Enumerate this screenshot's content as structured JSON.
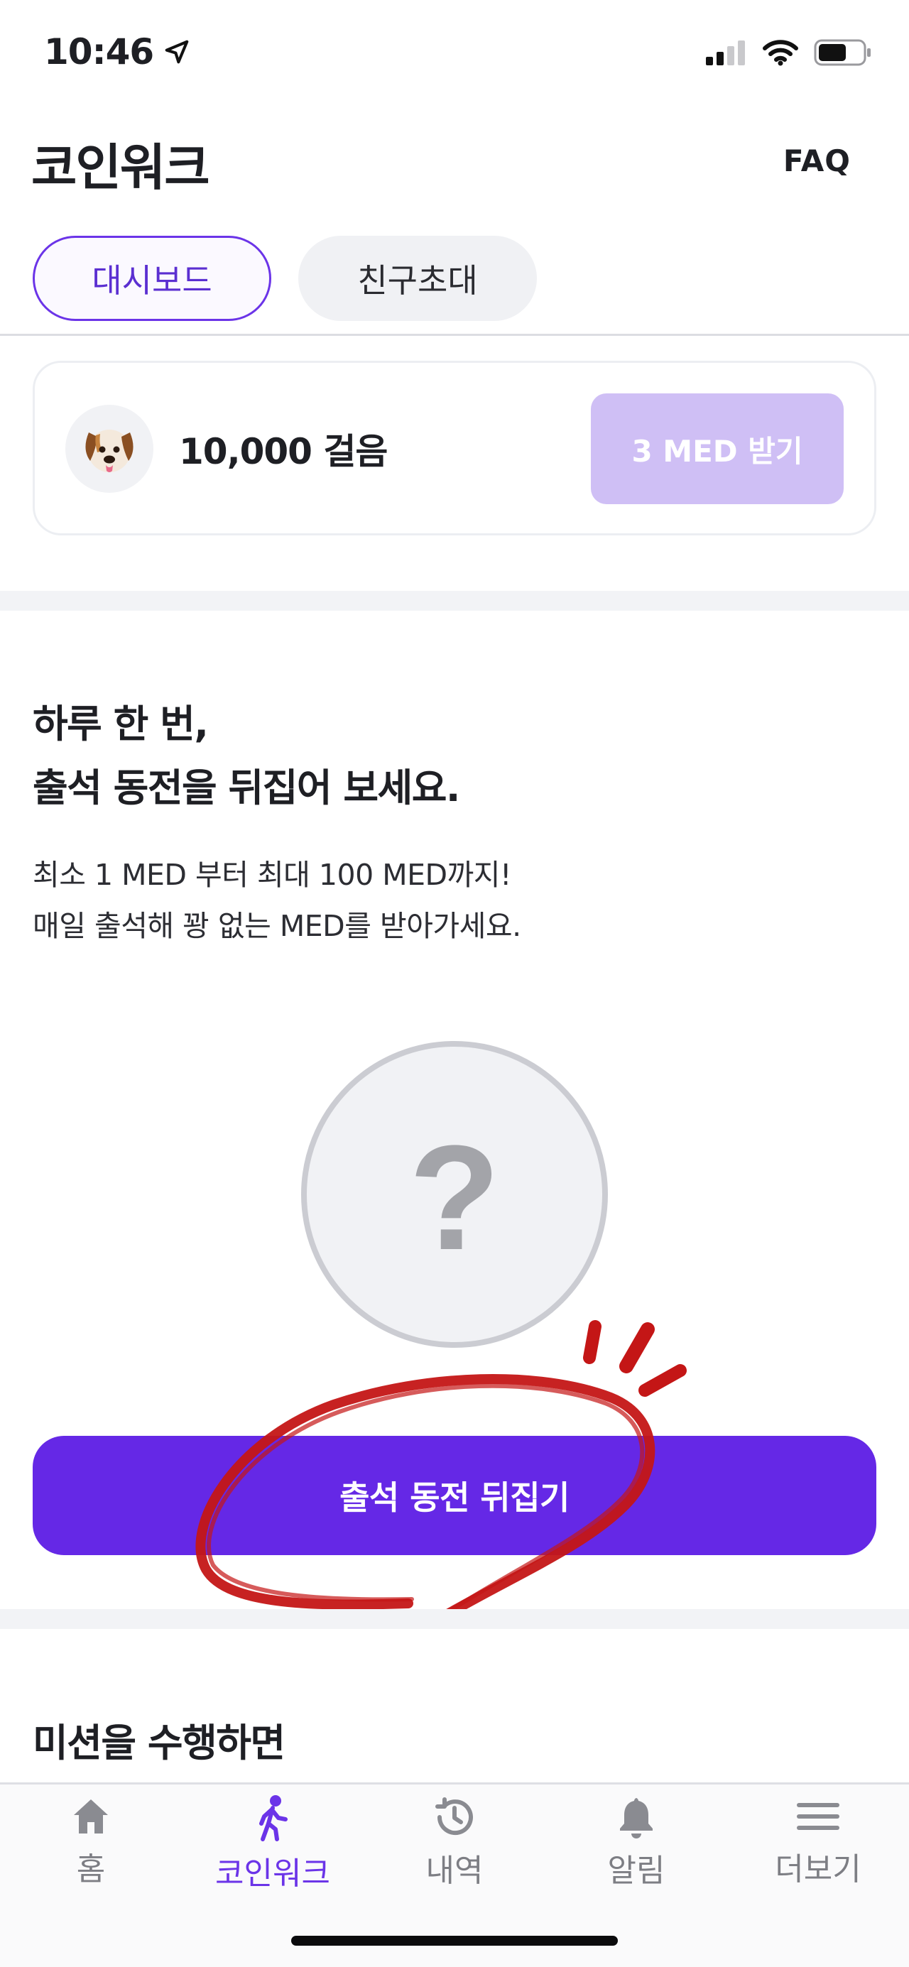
{
  "status_bar": {
    "time": "10:46"
  },
  "header": {
    "title": "코인워크",
    "faq_label": "FAQ"
  },
  "tabs": [
    {
      "label": "대시보드",
      "active": true
    },
    {
      "label": "친구초대",
      "active": false
    }
  ],
  "steps_card": {
    "avatar_icon": "dog-face-icon",
    "steps_text": "10,000 걸음",
    "claim_label": "3 MED 받기"
  },
  "attendance": {
    "headline_line1": "하루 한 번,",
    "headline_line2": "출석 동전을 뒤집어 보세요.",
    "desc_line1": "최소 1 MED 부터 최대 100 MED까지!",
    "desc_line2": "매일 출석해 꽝 없는 MED를 받아가세요.",
    "coin_symbol": "?",
    "flip_label": "출석 동전 뒤집기"
  },
  "mission": {
    "text": "미션을 수행하면"
  },
  "bottom_nav": [
    {
      "label": "홈",
      "icon": "home-icon",
      "active": false
    },
    {
      "label": "코인워크",
      "icon": "walking-icon",
      "active": true
    },
    {
      "label": "내역",
      "icon": "history-icon",
      "active": false
    },
    {
      "label": "알림",
      "icon": "bell-icon",
      "active": false
    },
    {
      "label": "더보기",
      "icon": "menu-icon",
      "active": false
    }
  ],
  "colors": {
    "accent": "#6528e6",
    "accent_light": "#cfbff5",
    "annotation_red": "#c41616"
  }
}
